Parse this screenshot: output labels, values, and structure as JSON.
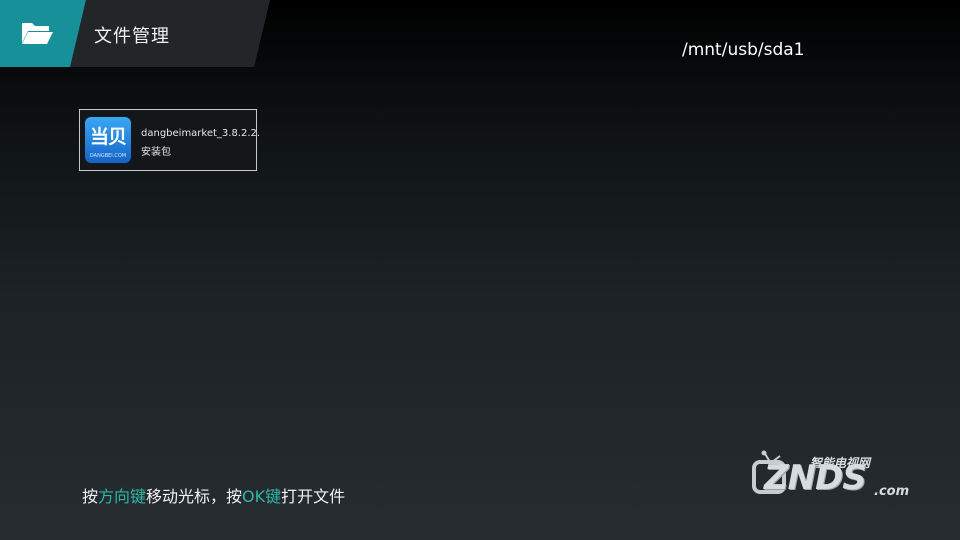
{
  "header": {
    "title": "文件管理",
    "icon": "folder-open-icon",
    "accent_color": "#18909a"
  },
  "path": "/mnt/usb/sda1",
  "files": [
    {
      "name": "dangbeimarket_3.8.2.2.",
      "type": "安装包",
      "icon_text": "当贝",
      "icon_subtext": "DANGBEI.COM"
    }
  ],
  "hint": {
    "part1": "按",
    "key1": "方向键",
    "part2": "移动光标，按",
    "key2": "OK键",
    "part3": "打开文件",
    "highlight_color": "#2fb6a6"
  },
  "watermark": {
    "small": "智能电视网",
    "big": "ZNDS",
    "suffix": ".com"
  }
}
